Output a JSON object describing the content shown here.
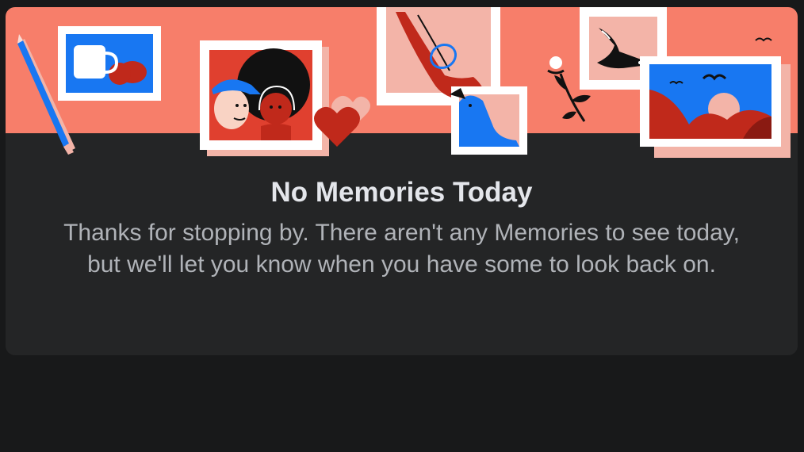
{
  "memories_card": {
    "title": "No Memories Today",
    "message": "Thanks for stopping by. There aren't any Memories to see today, but we'll let you know when you have some to look back on."
  },
  "colors": {
    "page_background": "#18191a",
    "card_background": "#242526",
    "banner_background": "#f77e6a",
    "title_text": "#e4e6eb",
    "body_text": "#b0b3b8",
    "accent_blue": "#1877f2",
    "accent_red": "#c0291b"
  },
  "illustration": {
    "icons": [
      "pencil-icon",
      "coffee-mug-icon",
      "couple-photo-icon",
      "heart-icon",
      "hand-petting-dog-icon",
      "flower-icon",
      "bird-icon",
      "landscape-photo-icon"
    ]
  }
}
